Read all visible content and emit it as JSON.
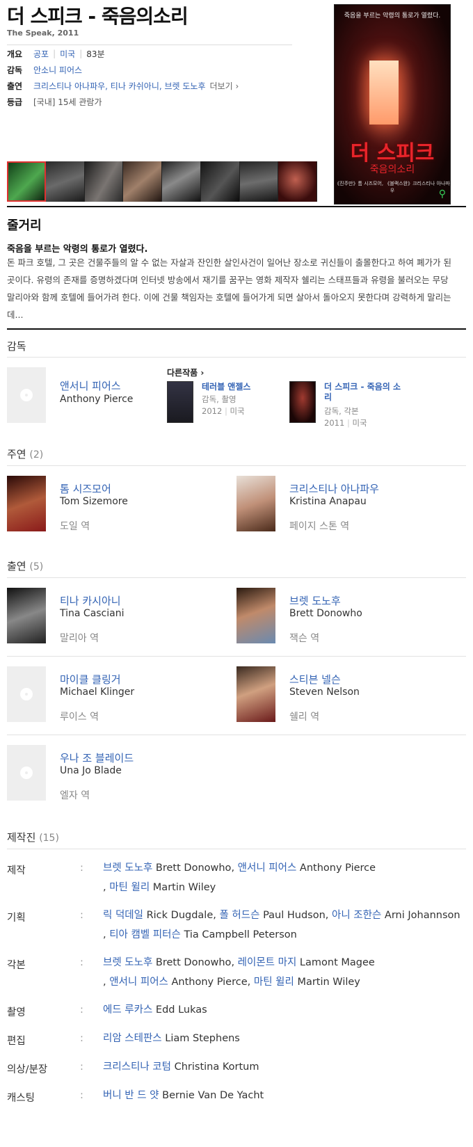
{
  "movie": {
    "title": "더 스피크 - 죽음의소리",
    "subtitle": "The Speak, 2011",
    "overview_label": "개요",
    "genre": "공포",
    "country": "미국",
    "runtime": "83분",
    "director_label": "감독",
    "director": "안소니 피어스",
    "cast_label": "출연",
    "cast_short": "크리스티나 아나파우, 티나 카쉬아니, 브렛 도노후",
    "more_label": "더보기",
    "rating_label": "등급",
    "rating": "[국내] 15세 관람가"
  },
  "poster": {
    "tagline": "죽음을 부르는 악령의 통로가 열렸다.",
    "title": "더 스피크",
    "subtitle": "죽음의소리",
    "credits": "《진주만》톰 시즈모어, 《블랙스완》크리스티나 아나파우"
  },
  "synopsis": {
    "heading": "줄거리",
    "tagline": "죽음을 부르는 악령의 통로가 열렸다.",
    "lines": [
      "돈 파크 호텔, 그 곳은 건물주들의 알 수 없는 자살과 잔인한 살인사건이 일어난 장소로 귀신들이 출몰한다고 하여 폐가가 된",
      "곳이다. 유령의 존재를 증명하겠다며 인터넷 방송에서 재기를 꿈꾸는 영화 제작자 쉘리는 스태프들과 유령을 불러오는 무당",
      "말리아와 함께 호텔에 들어가려 한다. 이에 건물 책임자는 호텔에 들어가게 되면 살아서 돌아오지 못한다며 강력하게 말리는",
      "데..."
    ]
  },
  "director_section": {
    "label": "감독",
    "name_ko": "앤서니 피어스",
    "name_en": "Anthony Pierce",
    "other_works_label": "다른작품",
    "works": [
      {
        "title": "테러블 앤젤스",
        "role": "감독, 촬영",
        "year": "2012",
        "country": "미국"
      },
      {
        "title": "더 스피크 - 죽음의 소리",
        "role": "감독, 각본",
        "year": "2011",
        "country": "미국"
      }
    ]
  },
  "lead": {
    "label": "주연",
    "count": "(2)",
    "people": [
      {
        "ko": "톰 시즈모어",
        "en": "Tom Sizemore",
        "role": "도일 역"
      },
      {
        "ko": "크리스티나 아나파우",
        "en": "Kristina Anapau",
        "role": "페이지 스톤 역"
      }
    ]
  },
  "supporting": {
    "label": "출연",
    "count": "(5)",
    "people": [
      {
        "ko": "티나 카시아니",
        "en": "Tina Casciani",
        "role": "말리아 역"
      },
      {
        "ko": "브렛 도노후",
        "en": "Brett Donowho",
        "role": "잭슨 역"
      },
      {
        "ko": "마이클 클링거",
        "en": "Michael Klinger",
        "role": "루이스 역"
      },
      {
        "ko": "스티븐 넬슨",
        "en": "Steven Nelson",
        "role": "쉘리 역"
      },
      {
        "ko": "우나 조 블레이드",
        "en": "Una Jo Blade",
        "role": "엘자 역"
      }
    ]
  },
  "crew": {
    "label": "제작진",
    "count": "(15)",
    "colon": ":",
    "rows": [
      {
        "label": "제작",
        "items": [
          {
            "ko": "브렛 도노후",
            "en": "Brett Donowho"
          },
          {
            "ko": "앤서니 피어스",
            "en": "Anthony Pierce"
          },
          {
            "ko": "마틴 윌리",
            "en": "Martin Wiley"
          }
        ]
      },
      {
        "label": "기획",
        "items": [
          {
            "ko": "릭 덕데일",
            "en": "Rick Dugdale"
          },
          {
            "ko": "폴 허드슨",
            "en": "Paul Hudson"
          },
          {
            "ko": "아니 조한슨",
            "en": "Arni Johannson"
          },
          {
            "ko": "티아 캠벨 피터슨",
            "en": "Tia Campbell Peterson"
          }
        ]
      },
      {
        "label": "각본",
        "items": [
          {
            "ko": "브렛 도노후",
            "en": "Brett Donowho"
          },
          {
            "ko": "레이몬트 마지",
            "en": "Lamont Magee"
          },
          {
            "ko": "앤서니 피어스",
            "en": "Anthony Pierce"
          },
          {
            "ko": "마틴 윌리",
            "en": "Martin Wiley"
          }
        ]
      },
      {
        "label": "촬영",
        "items": [
          {
            "ko": "에드 루카스",
            "en": "Edd Lukas"
          }
        ]
      },
      {
        "label": "편집",
        "items": [
          {
            "ko": "리암 스테판스",
            "en": "Liam Stephens"
          }
        ]
      },
      {
        "label": "의상/분장",
        "items": [
          {
            "ko": "크리스티나 코텀",
            "en": "Christina Kortum"
          }
        ]
      },
      {
        "label": "캐스팅",
        "items": [
          {
            "ko": "버니 반 드 얏",
            "en": "Bernie Van De Yacht"
          }
        ]
      }
    ]
  },
  "colors": {
    "link": "#3363b4",
    "accent_red": "#e8242a"
  }
}
